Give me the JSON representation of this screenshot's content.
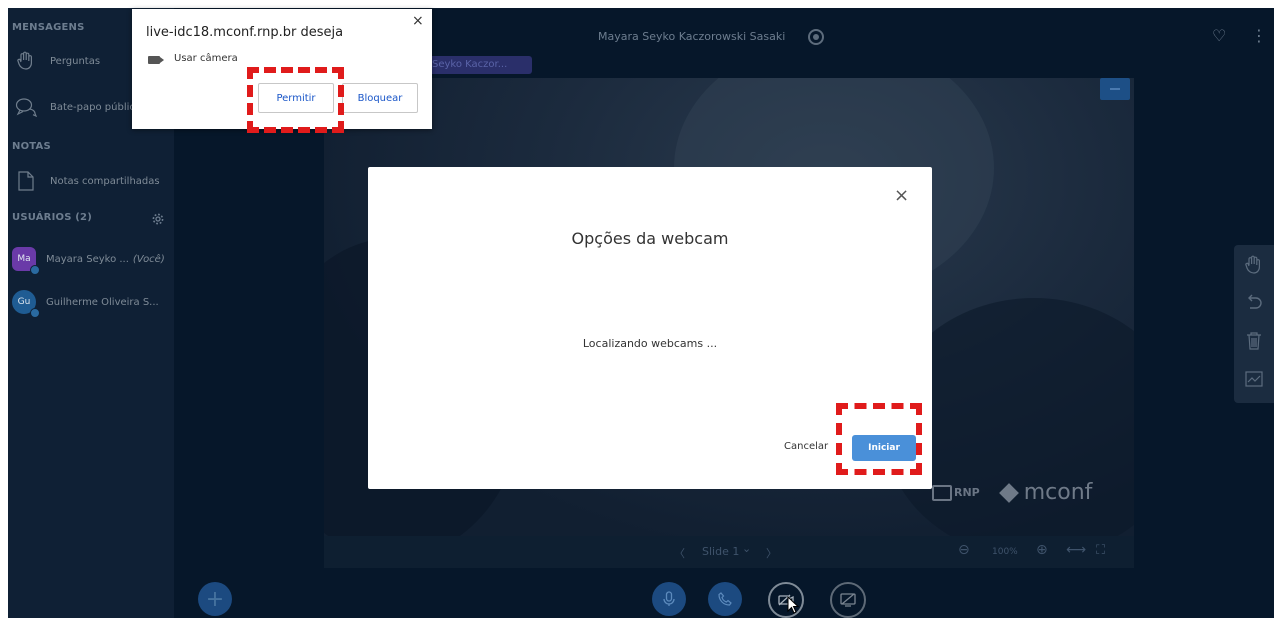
{
  "sidebar": {
    "messages_heading": "MENSAGENS",
    "questions": "Perguntas",
    "public_chat": "Bate-papo públic",
    "notes_heading": "NOTAS",
    "shared_notes": "Notas compartilhadas",
    "users_heading": "USUÁRIOS (2)",
    "users": [
      {
        "initials": "Ma",
        "name": "Mayara Seyko ...",
        "you": "(Você)",
        "color": "#6a3aa8"
      },
      {
        "initials": "Gu",
        "name": "Guilherme Oliveira S...",
        "color": "#1f5c93"
      }
    ]
  },
  "topbar": {
    "meeting_title": "Mayara Seyko Kaczorowski Sasaki"
  },
  "presentation": {
    "presenter_tag": "Seyko Kaczor...",
    "slide_label": "Slide 1",
    "zoom": "100%",
    "logo_rnp": "RNP",
    "logo_mconf": "mconf"
  },
  "modal": {
    "title": "Opções da webcam",
    "status": "Localizando webcams ...",
    "cancel": "Cancelar",
    "start": "Iniciar"
  },
  "permission": {
    "title": "live-idc18.mconf.rnp.br deseja",
    "camera_label": "Usar câmera",
    "allow": "Permitir",
    "block": "Bloquear"
  },
  "icons": {
    "close": "×",
    "heart": "♡",
    "kebab": "⋮",
    "plus": "+",
    "chevron_left": "〈",
    "chevron_right": "〉",
    "chevron_down": "⌄",
    "zoom_out": "⊖",
    "zoom_in": "⊕",
    "fit_width": "⟷",
    "fullscreen": "⛶"
  },
  "colors": {
    "app_bg": "#06172a",
    "sidebar_bg": "#0f2035",
    "primary_blue": "#4a90d9",
    "highlight_red": "#e01b1b"
  }
}
